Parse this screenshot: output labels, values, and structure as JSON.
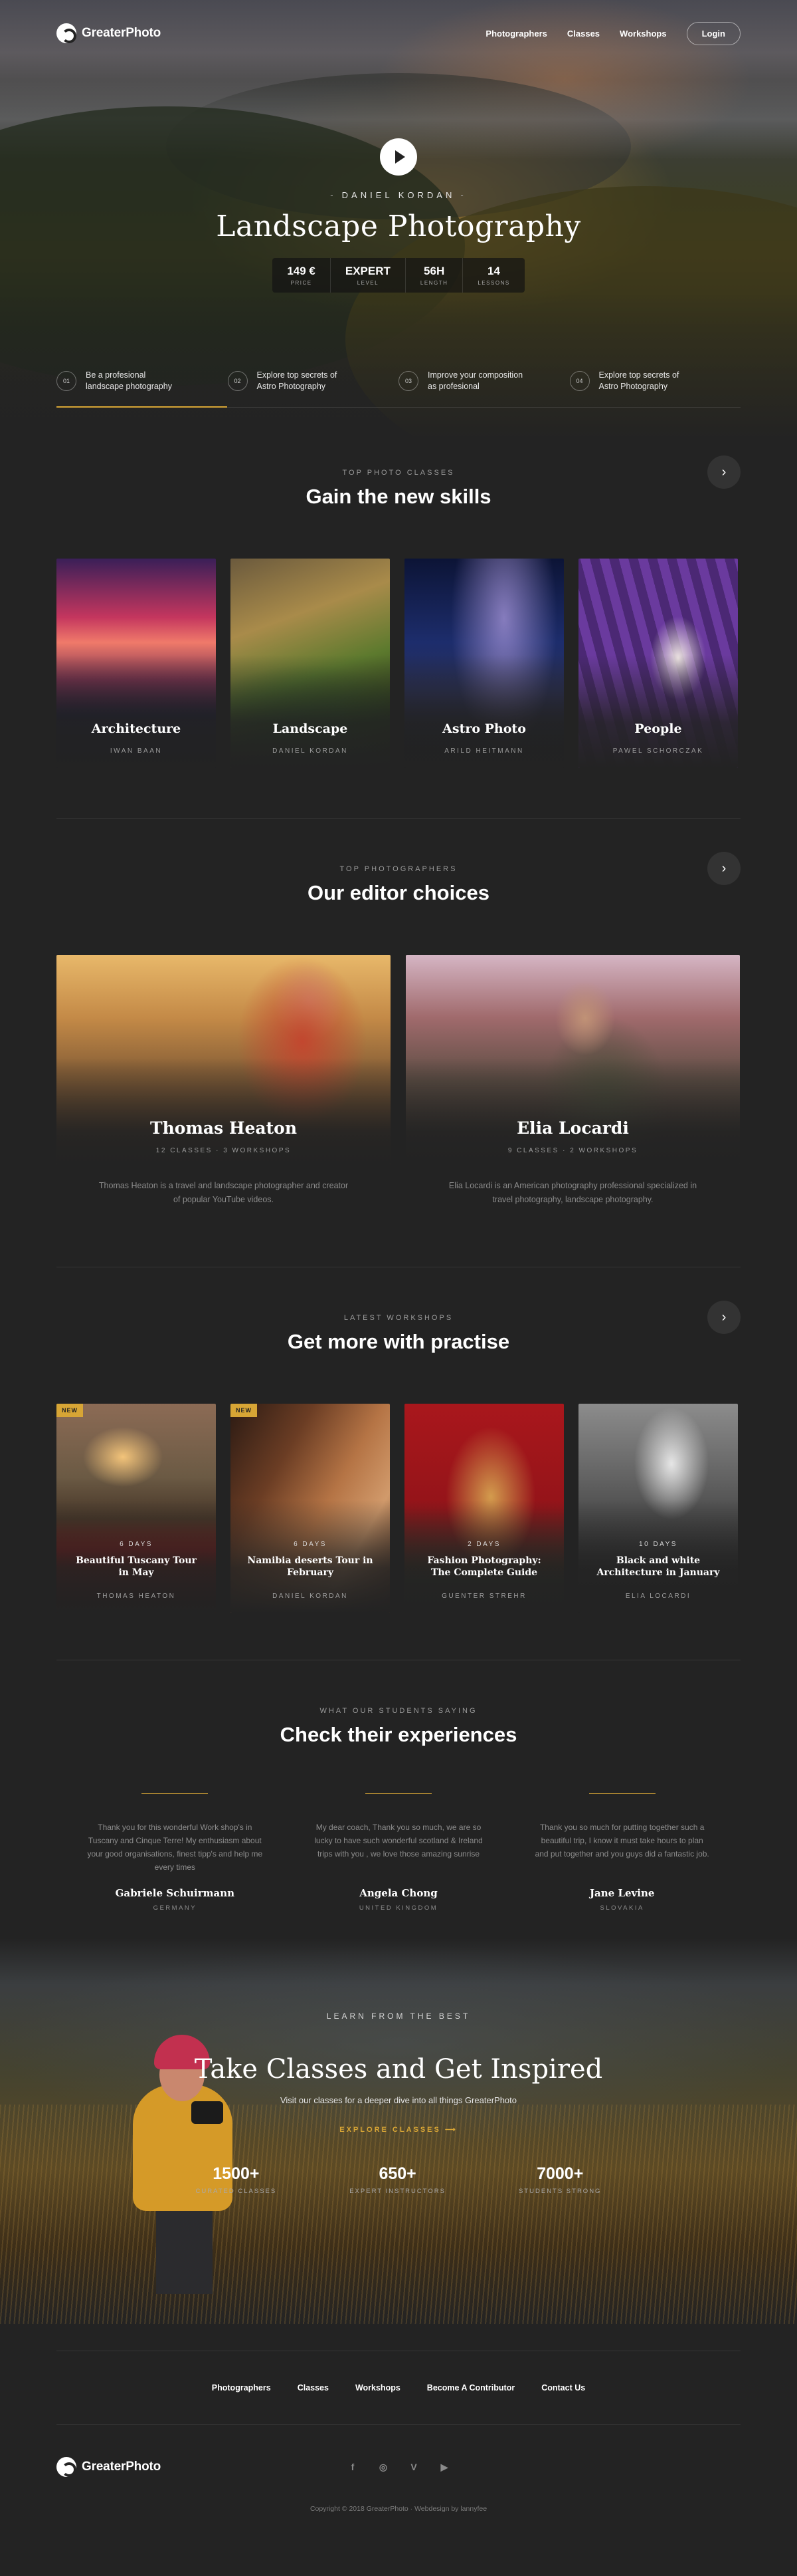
{
  "brand": {
    "name": "GreaterPhoto"
  },
  "nav": {
    "links": [
      "Photographers",
      "Classes",
      "Workshops"
    ],
    "login": "Login"
  },
  "hero": {
    "author": "DANIEL KORDAN",
    "title": "Landscape Photography",
    "stats": [
      {
        "value": "149 €",
        "label": "PRICE"
      },
      {
        "value": "EXPERT",
        "label": "LEVEL"
      },
      {
        "value": "56H",
        "label": "LENGTH"
      },
      {
        "value": "14",
        "label": "LESSONS"
      }
    ],
    "features": [
      {
        "num": "01",
        "text": "Be a profesional landscape photography"
      },
      {
        "num": "02",
        "text": "Explore top secrets of Astro Photography"
      },
      {
        "num": "03",
        "text": "Improve your composition as profesional"
      },
      {
        "num": "04",
        "text": "Explore top secrets of Astro Photography"
      }
    ]
  },
  "classes": {
    "eyebrow": "TOP PHOTO CLASSES",
    "title": "Gain the new skills",
    "items": [
      {
        "title": "Architecture",
        "author": "IWAN BAAN"
      },
      {
        "title": "Landscape",
        "author": "DANIEL KORDAN"
      },
      {
        "title": "Astro Photo",
        "author": "ARILD HEITMANN"
      },
      {
        "title": "People",
        "author": "PAWEL SCHORCZAK"
      }
    ]
  },
  "editors": {
    "eyebrow": "TOP PHOTOGRAPHERS",
    "title": "Our editor choices",
    "items": [
      {
        "name": "Thomas Heaton",
        "meta": "12 CLASSES · 3 WORKSHOPS",
        "desc": "Thomas Heaton is a travel and landscape photographer and creator of popular YouTube videos."
      },
      {
        "name": "Elia Locardi",
        "meta": "9 CLASSES · 2 WORKSHOPS",
        "desc": "Elia Locardi is an American photography professional specialized in travel photography, landscape photography."
      }
    ]
  },
  "workshops": {
    "eyebrow": "LATEST WORKSHOPS",
    "title": "Get more with practise",
    "badge": "NEW",
    "items": [
      {
        "days": "6 DAYS",
        "title": "Beautiful Tuscany Tour in May",
        "author": "THOMAS HEATON",
        "new": true
      },
      {
        "days": "6 DAYS",
        "title": "Namibia deserts Tour in February",
        "author": "DANIEL KORDAN",
        "new": true
      },
      {
        "days": "2 DAYS",
        "title": "Fashion Photography: The Complete Guide",
        "author": "GUENTER STREHR",
        "new": false
      },
      {
        "days": "10 DAYS",
        "title": "Black and white Architecture in January",
        "author": "ELIA LOCARDI",
        "new": false
      }
    ]
  },
  "testimonials": {
    "eyebrow": "WHAT OUR STUDENTS SAYING",
    "title": "Check their experiences",
    "items": [
      {
        "quote": "Thank you for this wonderful Work shop's in Tuscany and Cinque Terre! My enthusiasm about your good organisations, finest tipp's and help me every times",
        "name": "Gabriele Schuirmann",
        "country": "GERMANY"
      },
      {
        "quote": "My dear coach, Thank you so much, we are so lucky to have such wonderful scotland & Ireland trips with you , we love those amazing sunrise",
        "name": "Angela Chong",
        "country": "UNITED KINGDOM"
      },
      {
        "quote": "Thank you so much for putting together such a beautiful trip, I know it must take hours to plan and put together and you guys did a fantastic job.",
        "name": "Jane Levine",
        "country": "SLOVAKIA"
      }
    ]
  },
  "cta": {
    "eyebrow": "LEARN FROM THE BEST",
    "title": "Take Classes and Get Inspired",
    "subtitle": "Visit our classes for a deeper dive into all things GreaterPhoto",
    "link": "EXPLORE CLASSES",
    "numbers": [
      {
        "value": "1500+",
        "label": "CURATED CLASSES"
      },
      {
        "value": "650+",
        "label": "EXPERT INSTRUCTORS"
      },
      {
        "value": "7000+",
        "label": "STUDENTS STRONG"
      }
    ]
  },
  "footer": {
    "links": [
      "Photographers",
      "Classes",
      "Workshops",
      "Become A Contributor",
      "Contact Us"
    ],
    "socials": [
      {
        "icon": "facebook-icon",
        "glyph": "f"
      },
      {
        "icon": "instagram-icon",
        "glyph": "◎"
      },
      {
        "icon": "vimeo-icon",
        "glyph": "V"
      },
      {
        "icon": "youtube-icon",
        "glyph": "▶"
      }
    ],
    "copyright": "Copyright © 2018 GreaterPhoto · Webdesign by lannyfee"
  },
  "colors": {
    "accent": "#d7a535",
    "background": "#232323"
  }
}
